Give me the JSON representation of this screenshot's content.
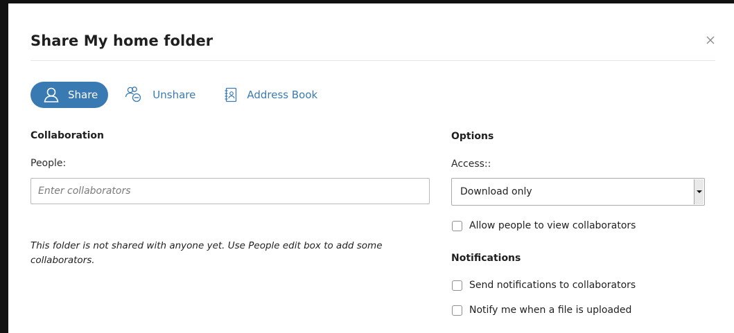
{
  "dialog": {
    "title": "Share My home folder",
    "close_icon": "close-icon"
  },
  "tabs": [
    {
      "label": "Share",
      "icon": "user-icon",
      "active": true
    },
    {
      "label": "Unshare",
      "icon": "unshare-users-icon",
      "active": false
    },
    {
      "label": "Address Book",
      "icon": "address-book-icon",
      "active": false
    }
  ],
  "collaboration": {
    "title": "Collaboration",
    "people_label": "People:",
    "people_placeholder": "Enter collaborators",
    "people_value": "",
    "info_text": "This folder is not shared with anyone yet. Use People edit box to add some collaborators."
  },
  "options": {
    "title": "Options",
    "access_label": "Access::",
    "access_value": "Download only",
    "allow_view_label": "Allow people to view collaborators",
    "allow_view_checked": false
  },
  "notifications": {
    "title": "Notifications",
    "send_label": "Send notifications to collaborators",
    "send_checked": false,
    "upload_label": "Notify me when a file is uploaded",
    "upload_checked": false
  },
  "colors": {
    "accent": "#3a7ab3",
    "text": "#1f1f1f",
    "border": "#b8b8b8"
  }
}
